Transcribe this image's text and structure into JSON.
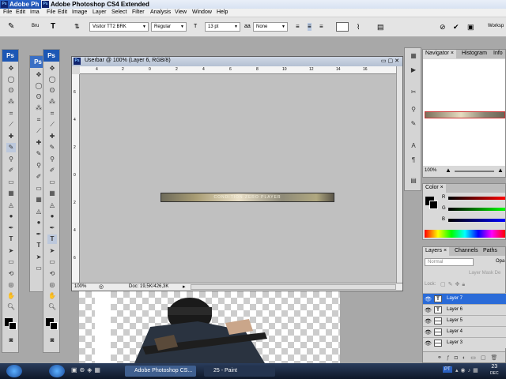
{
  "app": {
    "back_title": "Adobe Ph",
    "title": "Adobe Photoshop CS4 Extended",
    "ps_label": "Ps",
    "workspace_label": "Worksp"
  },
  "menu": {
    "back_items": [
      "File",
      "Edit",
      "Ima"
    ],
    "items": [
      "File",
      "Edit",
      "Image",
      "Layer",
      "Select",
      "Filter",
      "Analysis",
      "View",
      "Window",
      "Help"
    ]
  },
  "options": {
    "brush_label": "Bru",
    "font_family": "Visitor TT2 BRK",
    "font_style": "Regular",
    "font_size": "13 pt",
    "aa_label": "a",
    "aa_value": "None"
  },
  "document": {
    "title": "Userbar @ 100% (Layer 6, RGB/8)",
    "zoom": "100%",
    "doc_info": "Doc: 19,5K/426,3K",
    "banner_text": "CONDITION ZERO PLAYER",
    "ruler_h": [
      "4",
      "2",
      "0",
      "2",
      "4",
      "6",
      "8",
      "10",
      "12",
      "14",
      "16"
    ],
    "ruler_v": [
      "6",
      "4",
      "2",
      "0",
      "2",
      "4",
      "6"
    ]
  },
  "navigator": {
    "tabs": [
      "Navigator",
      "Histogram",
      "Info"
    ],
    "zoom": "100%"
  },
  "color_panel": {
    "tab": "Color",
    "r_label": "R",
    "g_label": "G",
    "b_label": "B"
  },
  "layers_panel": {
    "tabs": [
      "Layers",
      "Channels",
      "Paths"
    ],
    "blend_mode": "Normal",
    "opacity_label": "Opa",
    "mask_text": "Layer Mask De",
    "lock_label": "Lock:",
    "layers": [
      {
        "name": "Layer 7",
        "type": "T",
        "selected": true
      },
      {
        "name": "Layer 6",
        "type": "T",
        "selected": false
      },
      {
        "name": "Layer 5",
        "type": "",
        "selected": false
      },
      {
        "name": "Layer 4",
        "type": "",
        "selected": false
      },
      {
        "name": "Layer 3",
        "type": "",
        "selected": false
      }
    ]
  },
  "taskbar": {
    "buttons": [
      "Adobe Photoshop CS...",
      "25 - Paint"
    ],
    "lang": "PT",
    "clock_day": "23",
    "clock_month": "DEC"
  },
  "colors": {
    "titlebar_blue": "#1f4fad",
    "selected_layer": "#2a6bd8",
    "workspace_gray": "#a8a8a8",
    "taskbar": "#0e1728"
  }
}
